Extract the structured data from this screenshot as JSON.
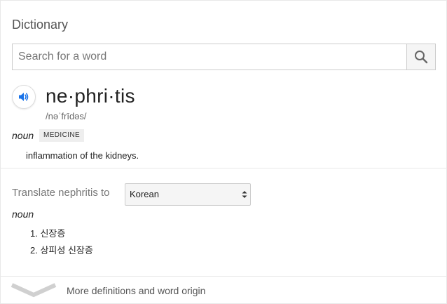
{
  "header": {
    "title": "Dictionary"
  },
  "search": {
    "placeholder": "Search for a word",
    "value": ""
  },
  "entry": {
    "headword": "ne·phri·tis",
    "phonetic": "/nəˈfrīdəs/",
    "part_of_speech": "noun",
    "label": "MEDICINE",
    "definition": "inflammation of the kidneys."
  },
  "translate": {
    "label": "Translate nephritis to",
    "selected_language": "Korean",
    "part_of_speech": "noun",
    "items": [
      {
        "number": "1.",
        "text": "신장증"
      },
      {
        "number": "2.",
        "text": "상피성 신장증"
      }
    ]
  },
  "footer": {
    "more_label": "More definitions and word origin"
  },
  "icons": {
    "search": "search-icon",
    "speaker": "speaker-icon",
    "chevron": "chevron-down-icon",
    "select_arrows": "select-arrows-icon"
  },
  "colors": {
    "speaker_blue": "#1a73e8"
  }
}
